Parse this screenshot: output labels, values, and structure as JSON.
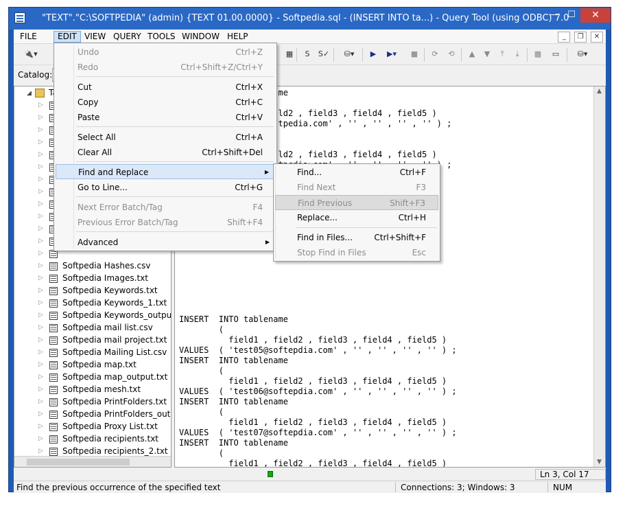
{
  "window": {
    "title": "\"TEXT\".\"C:\\SOFTPEDIA\" (admin) {TEXT 01.00.0000} - Softpedia.sql - (INSERT  INTO ta...) - Query Tool (using ODBC) 7.0",
    "min_glyph": "—",
    "max_glyph": "☐",
    "close_glyph": "✕"
  },
  "menubar": {
    "items": [
      "FILE",
      "EDIT",
      "VIEW",
      "QUERY",
      "TOOLS",
      "WINDOW",
      "HELP"
    ],
    "active": "EDIT",
    "mdi": [
      "_",
      "❐",
      "✕"
    ]
  },
  "catalog": {
    "label": "Catalog:"
  },
  "tree": {
    "root_label": "Ta",
    "items": [
      "Softpedia Hashes.csv",
      "Softpedia Images.txt",
      "Softpedia Keywords.txt",
      "Softpedia Keywords_1.txt",
      "Softpedia Keywords_outpu",
      "Softpedia mail list.csv",
      "Softpedia mail project.txt",
      "Softpedia Mailing List.csv",
      "Softpedia map.txt",
      "Softpedia map_output.txt",
      "Softpedia mesh.txt",
      "Softpedia PrintFolders.txt",
      "Softpedia PrintFolders_out",
      "Softpedia Proxy List.txt",
      "Softpedia recipients.txt",
      "Softpedia recipients_2.txt"
    ]
  },
  "editor": {
    "text": "                    me\n\n                    ld2 , field3 , field4 , field5 )\n                    tpedia.com' , '' , '' , '' , '' ) ;\n\n\n                    ld2 , field3 , field4 , field5 )\n                    tpedia.com' , '' , '' , '' , '' ) ;\n\n\n\n\n\n\n\n\n\n\n\n\n\n\nINSERT  INTO tablename\n        (\n          field1 , field2 , field3 , field4 , field5 )\nVALUES  ( 'test05@softepdia.com' , '' , '' , '' , '' ) ;\nINSERT  INTO tablename\n        (\n          field1 , field2 , field3 , field4 , field5 )\nVALUES  ( 'test06@softepdia.com' , '' , '' , '' , '' ) ;\nINSERT  INTO tablename\n        (\n          field1 , field2 , field3 , field4 , field5 )\nVALUES  ( 'test07@softepdia.com' , '' , '' , '' , '' ) ;\nINSERT  INTO tablename\n        (\n          field1 , field2 , field3 , field4 , field5 )\nVALUES  ( 'test08@softepdia.com' , '' , '' , '' , '' ) ;\nINSERT  INTO tablename\n        (\n          field1 , field2 , field3 , field4 , field5 )\nVALUES  ( 'test09@softepdia.com' , '' , '' , '' , '' ) ;\nINSERT  INTO tablename"
  },
  "edit_menu": {
    "undo": {
      "label": "Undo",
      "shortcut": "Ctrl+Z"
    },
    "redo": {
      "label": "Redo",
      "shortcut": "Ctrl+Shift+Z/Ctrl+Y"
    },
    "cut": {
      "label": "Cut",
      "shortcut": "Ctrl+X"
    },
    "copy": {
      "label": "Copy",
      "shortcut": "Ctrl+C"
    },
    "paste": {
      "label": "Paste",
      "shortcut": "Ctrl+V"
    },
    "select_all": {
      "label": "Select All",
      "shortcut": "Ctrl+A"
    },
    "clear_all": {
      "label": "Clear All",
      "shortcut": "Ctrl+Shift+Del"
    },
    "find_replace": {
      "label": "Find and Replace"
    },
    "goto_line": {
      "label": "Go to Line...",
      "shortcut": "Ctrl+G"
    },
    "next_error": {
      "label": "Next Error Batch/Tag",
      "shortcut": "F4"
    },
    "prev_error": {
      "label": "Previous Error Batch/Tag",
      "shortcut": "Shift+F4"
    },
    "advanced": {
      "label": "Advanced"
    }
  },
  "find_submenu": {
    "find": {
      "label": "Find...",
      "shortcut": "Ctrl+F"
    },
    "find_next": {
      "label": "Find Next",
      "shortcut": "F3"
    },
    "find_previous": {
      "label": "Find Previous",
      "shortcut": "Shift+F3"
    },
    "replace": {
      "label": "Replace...",
      "shortcut": "Ctrl+H"
    },
    "find_in_files": {
      "label": "Find in Files...",
      "shortcut": "Ctrl+Shift+F"
    },
    "stop_find": {
      "label": "Stop Find in Files",
      "shortcut": "Esc"
    }
  },
  "infobar": {
    "position": "Ln 3, Col 17"
  },
  "statusbar": {
    "message": "Find the previous occurrence of the specified text",
    "connections": "Connections: 3; Windows: 3",
    "num": "NUM"
  },
  "watermark": "SOFTPEDIA",
  "colors": {
    "titlebar": "#2a68c5",
    "close": "#c9423a",
    "highlight": "#dbe8f8"
  }
}
